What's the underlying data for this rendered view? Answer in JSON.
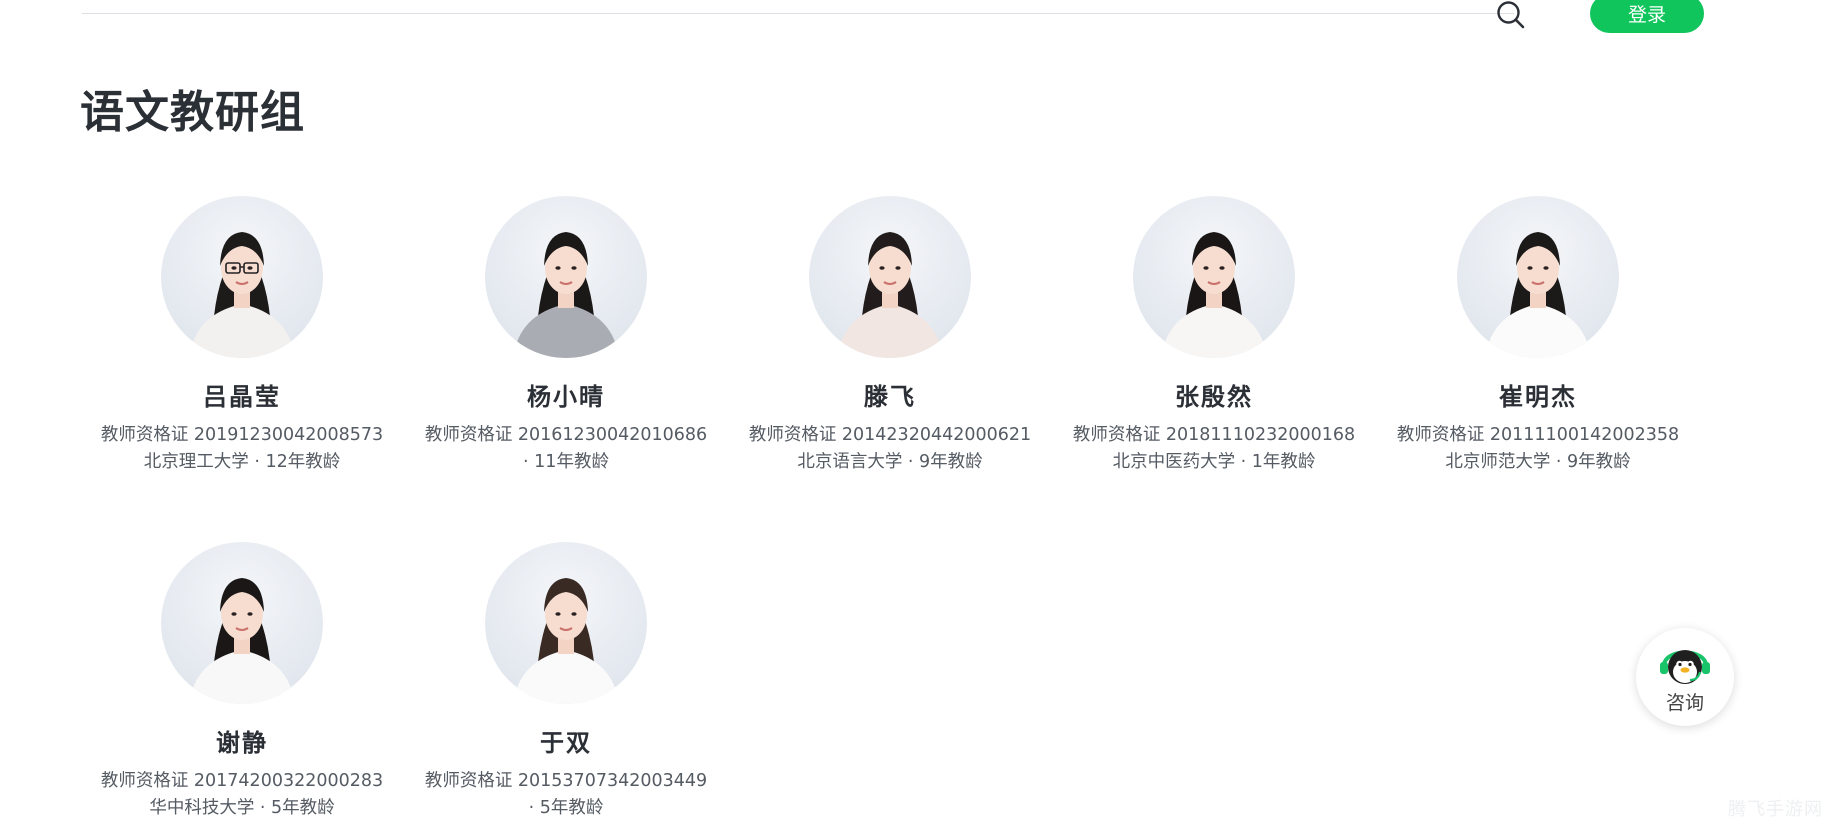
{
  "header": {
    "login_label": "登录",
    "search_icon": "search-icon"
  },
  "section": {
    "title": "语文教研组"
  },
  "teachers": [
    {
      "name": "吕晶莹",
      "cert": "教师资格证 20191230042008573",
      "detail": "北京理工大学 · 12年教龄",
      "hair": "#1d1a1a",
      "top": "#f3f1ef",
      "glasses": true
    },
    {
      "name": "杨小晴",
      "cert": "教师资格证 20161230042010686",
      "detail": "· 11年教龄",
      "hair": "#1b1818",
      "top": "#a9adb3",
      "glasses": false
    },
    {
      "name": "滕飞",
      "cert": "教师资格证 20142320442000621",
      "detail": "北京语言大学 · 9年教龄",
      "hair": "#221d1c",
      "top": "#f1e6e1",
      "glasses": false
    },
    {
      "name": "张殷然",
      "cert": "教师资格证 20181110232000168",
      "detail": "北京中医药大学 · 1年教龄",
      "hair": "#1a1616",
      "top": "#f7f6f5",
      "glasses": false
    },
    {
      "name": "崔明杰",
      "cert": "教师资格证 20111100142002358",
      "detail": "北京师范大学 · 9年教龄",
      "hair": "#1c1919",
      "top": "#fbfbfb",
      "glasses": false
    },
    {
      "name": "谢静",
      "cert": "教师资格证 20174200322000283",
      "detail": "华中科技大学 · 5年教龄",
      "hair": "#1b1717",
      "top": "#f8f8f8",
      "glasses": false
    },
    {
      "name": "于双",
      "cert": "教师资格证 20153707342003449",
      "detail": "· 5年教龄",
      "hair": "#3a2a24",
      "top": "#fafafa",
      "glasses": false
    }
  ],
  "consult": {
    "label": "咨询",
    "icon": "penguin-headset-icon"
  },
  "watermark": {
    "text": "腾飞手游网"
  },
  "colors": {
    "accent": "#10c55b",
    "title": "#2b2f36",
    "info": "#555b63"
  }
}
